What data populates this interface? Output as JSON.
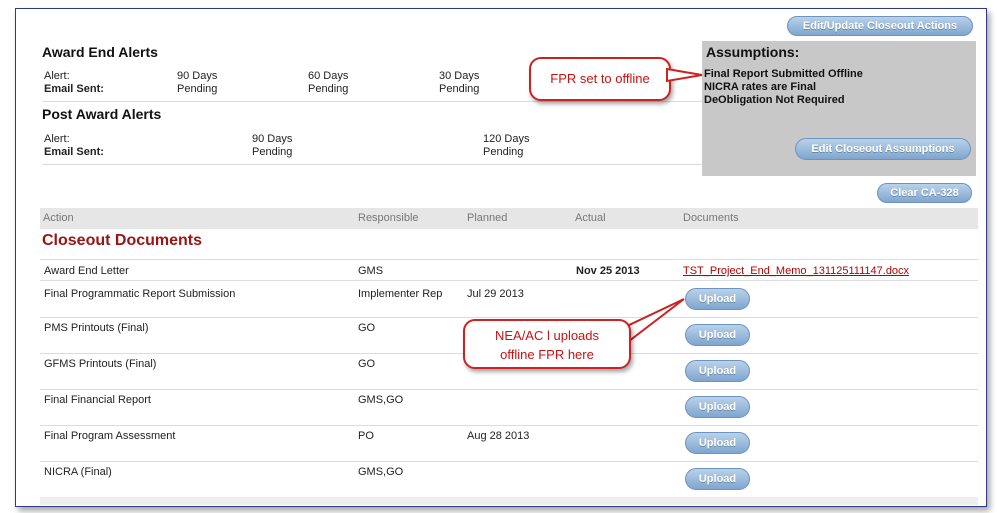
{
  "buttons": {
    "edit_update": "Edit/Update Closeout Actions",
    "edit_assumptions": "Edit Closeout Assumptions",
    "clear_ca": "Clear CA-328",
    "upload": "Upload"
  },
  "award_end_alerts": {
    "title": "Award End Alerts",
    "alert_label": "Alert:",
    "email_label": "Email Sent:",
    "cols": [
      {
        "days": "90 Days",
        "status": "Pending"
      },
      {
        "days": "60 Days",
        "status": "Pending"
      },
      {
        "days": "30 Days",
        "status": "Pending"
      }
    ]
  },
  "post_award_alerts": {
    "title": "Post Award Alerts",
    "alert_label": "Alert:",
    "email_label": "Email Sent:",
    "cols": [
      {
        "days": "90 Days",
        "status": "Pending"
      },
      {
        "days": "120 Days",
        "status": "Pending"
      }
    ]
  },
  "assumptions": {
    "title": "Assumptions:",
    "lines": [
      "Final Report Submitted Offline",
      "NICRA rates are Final",
      "DeObligation Not Required"
    ]
  },
  "table": {
    "headers": [
      "Action",
      "Responsible",
      "Planned",
      "Actual",
      "Documents"
    ],
    "section_title": "Closeout Documents",
    "rows": [
      {
        "action": "Award End Letter",
        "responsible": "GMS",
        "planned": "",
        "actual": "Nov 25 2013",
        "document": "TST_Project_End_Memo_131125111147.docx"
      },
      {
        "action": "Final Programmatic Report Submission",
        "responsible": "Implementer Rep",
        "planned": "Jul 29 2013",
        "actual": "",
        "document": ""
      },
      {
        "action": "PMS Printouts (Final)",
        "responsible": "GO",
        "planned": "",
        "actual": "",
        "document": ""
      },
      {
        "action": "GFMS Printouts (Final)",
        "responsible": "GO",
        "planned": "",
        "actual": "",
        "document": ""
      },
      {
        "action": "Final Financial Report",
        "responsible": "GMS,GO",
        "planned": "",
        "actual": "",
        "document": ""
      },
      {
        "action": "Final Program Assessment",
        "responsible": "PO",
        "planned": "Aug 28 2013",
        "actual": "",
        "document": ""
      },
      {
        "action": "NICRA (Final)",
        "responsible": "GMS,GO",
        "planned": "",
        "actual": "",
        "document": ""
      }
    ]
  },
  "callouts": {
    "fpr": "FPR set to offline",
    "nea_line1": "NEA/AC l uploads",
    "nea_line2": "offline FPR here"
  }
}
